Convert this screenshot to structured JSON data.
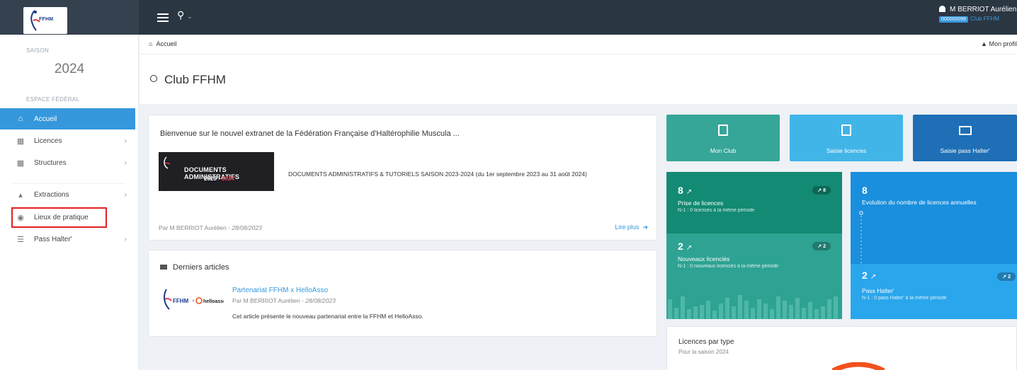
{
  "header": {
    "logo_text": "FFHM",
    "user_name": "M BERRIOT Aurélien",
    "club_id": "000000099",
    "club_name": "Club FFHM"
  },
  "sidebar": {
    "season_label": "SAISON",
    "season_year": "2024",
    "section_label": "ESPACE FÉDÉRAL",
    "items": [
      {
        "label": "Accueil",
        "icon": "home-icon",
        "active": true,
        "has_arrow": false
      },
      {
        "label": "Licences",
        "icon": "card-icon",
        "active": false,
        "has_arrow": true
      },
      {
        "label": "Structures",
        "icon": "building-icon",
        "active": false,
        "has_arrow": true
      },
      {
        "label": "Extractions",
        "icon": "export-icon",
        "active": false,
        "has_arrow": true
      },
      {
        "label": "Lieux de pratique",
        "icon": "location-icon",
        "active": false,
        "has_arrow": false
      },
      {
        "label": "Pass Halter'",
        "icon": "barcode-icon",
        "active": false,
        "has_arrow": true
      }
    ]
  },
  "breadcrumb": {
    "home_label": "Accueil",
    "profile_label": "Mon profil"
  },
  "page": {
    "title": "Club FFHM"
  },
  "welcome": {
    "title": "Bienvenue sur le nouvel extranet de la Fédération Française d'Haltérophilie Muscula ...",
    "banner_line1": "DOCUMENTS ADMINISTRATIFS",
    "banner_year_a": "2023",
    "banner_sep": " - ",
    "banner_year_b": "2024",
    "description": "DOCUMENTS ADMINISTRATIFS & TUTORIELS SAISON 2023-2024 (du 1er septembre 2023 au 31 août 2024)",
    "author": "Par M BERRIOT Aurélien - ",
    "date": "28/08/2023",
    "read_more": "Lire plus"
  },
  "articles": {
    "heading": "Derniers articles",
    "items": [
      {
        "title": "Partenariat FFHM x HelloAsso",
        "author": "Par M BERRIOT Aurélien - ",
        "date": "28/08/2023",
        "description": "Cet article présente le nouveau partenariat entre la FFHM et HelloAsso.",
        "logo_a": "FFHM",
        "logo_b": "helloasso"
      }
    ]
  },
  "tiles": [
    {
      "label": "Mon Club",
      "icon": "building-icon",
      "color": "#36a699"
    },
    {
      "label": "Saisie licences",
      "icon": "list-icon",
      "color": "#42b5e8"
    },
    {
      "label": "Saisie pass Halter'",
      "icon": "id-card-icon",
      "color": "#1e6fb6"
    }
  ],
  "stats": {
    "prise": {
      "value": "8",
      "label": "Prise de licences",
      "sub": "N-1 : 0 licences à la même période",
      "badge": "8",
      "color": "#138a73"
    },
    "nouveaux": {
      "value": "2",
      "label": "Nouveaux licenciés",
      "sub": "N-1 : 0 nouveaux licenciés à la même période",
      "badge": "2",
      "color": "#2ea393"
    },
    "evolution": {
      "value": "8",
      "label": "Evolution du nombre de licences annuelles",
      "color": "#1a8fdd"
    },
    "pass": {
      "value": "2",
      "label": "Pass Halter'",
      "sub": "N-1 : 0 pass Halter' à la même période",
      "badge": "2",
      "color": "#2aa6ec"
    }
  },
  "licences_par_type": {
    "title": "Licences par type",
    "subtitle": "Pour la saison 2024",
    "accent": "#f2511b"
  }
}
